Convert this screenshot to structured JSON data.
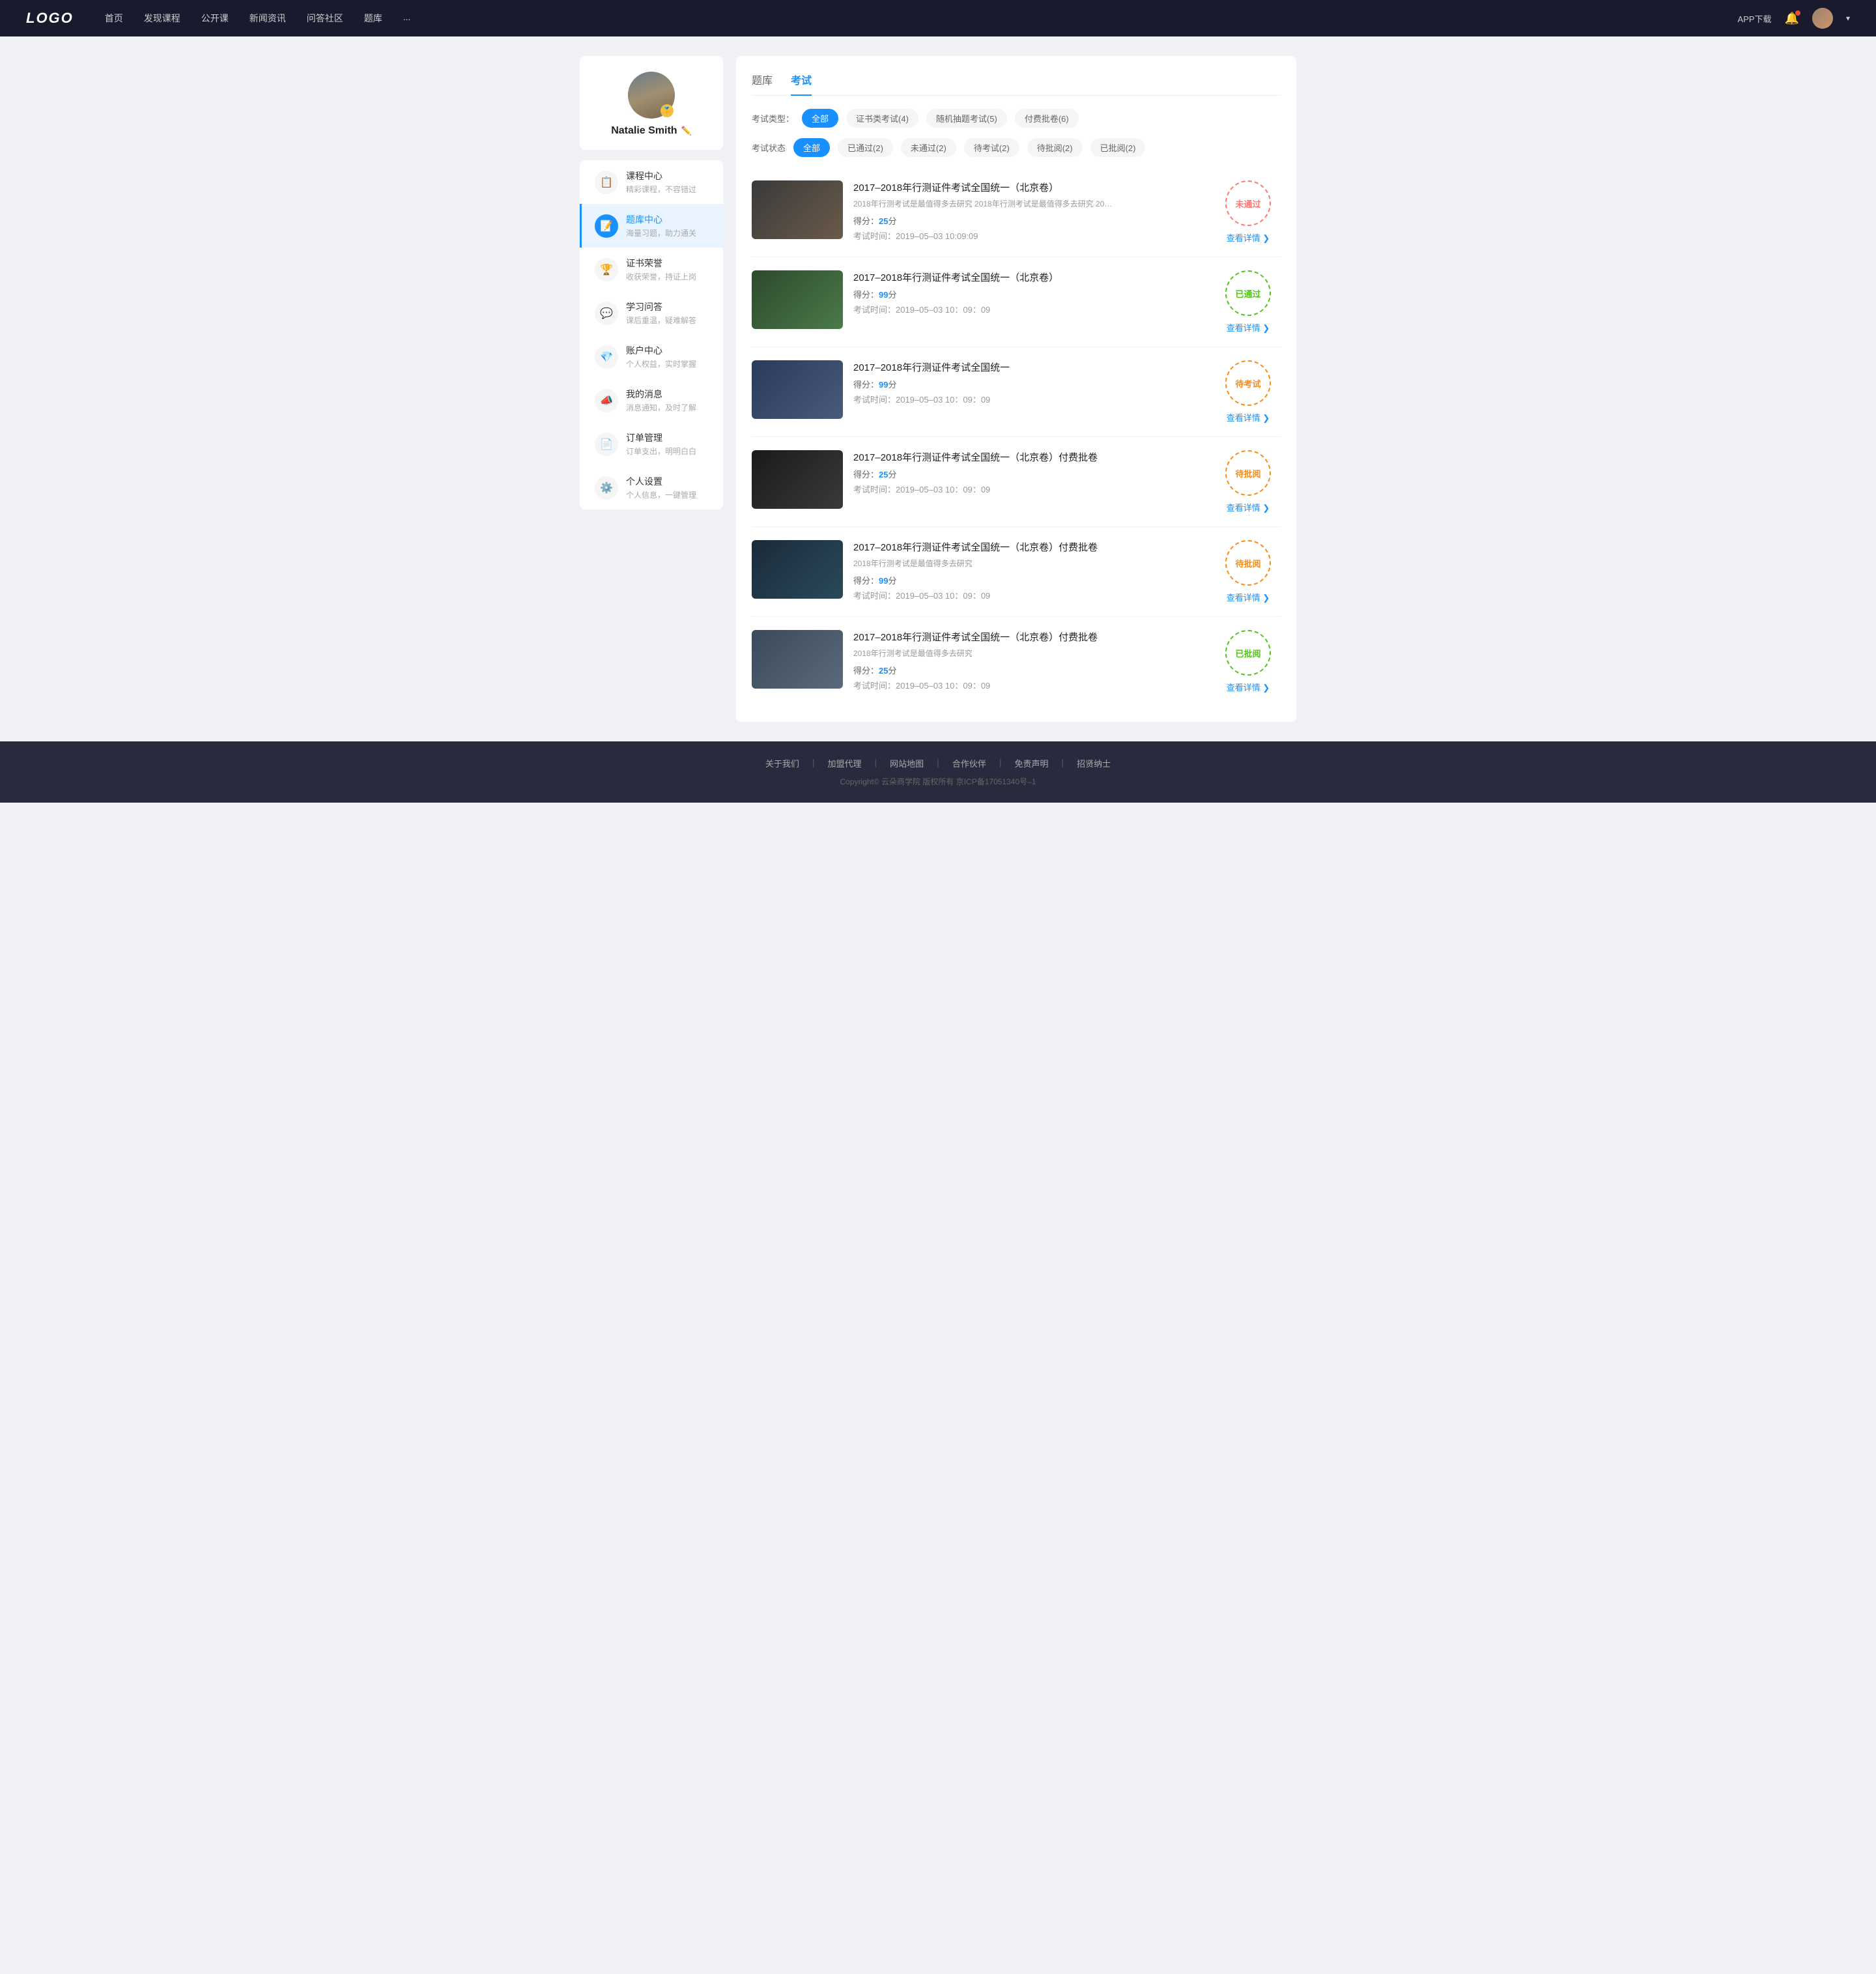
{
  "navbar": {
    "logo": "LOGO",
    "links": [
      "首页",
      "发现课程",
      "公开课",
      "新闻资讯",
      "问答社区",
      "题库",
      "..."
    ],
    "app_download": "APP下载",
    "dropdown_label": "▾"
  },
  "sidebar": {
    "username": "Natalie Smith",
    "badge": "🏅",
    "menu_items": [
      {
        "id": "course",
        "icon": "📋",
        "title": "课程中心",
        "sub": "精彩课程，不容错过"
      },
      {
        "id": "question-bank",
        "icon": "📝",
        "title": "题库中心",
        "sub": "海量习题，助力通关"
      },
      {
        "id": "certificate",
        "icon": "🏆",
        "title": "证书荣誉",
        "sub": "收获荣誉，持证上岗"
      },
      {
        "id": "qa",
        "icon": "💬",
        "title": "学习问答",
        "sub": "课后重温，疑难解答"
      },
      {
        "id": "account",
        "icon": "💎",
        "title": "账户中心",
        "sub": "个人权益，实时掌握"
      },
      {
        "id": "messages",
        "icon": "📣",
        "title": "我的消息",
        "sub": "消息通知，及时了解"
      },
      {
        "id": "orders",
        "icon": "📄",
        "title": "订单管理",
        "sub": "订单支出，明明白白"
      },
      {
        "id": "settings",
        "icon": "⚙️",
        "title": "个人设置",
        "sub": "个人信息，一键管理"
      }
    ]
  },
  "content": {
    "tab_question_bank": "题库",
    "tab_exam": "考试",
    "active_tab": "exam",
    "filter_type_label": "考试类型：",
    "filter_type_options": [
      {
        "label": "全部",
        "active": true
      },
      {
        "label": "证书类考试(4)",
        "active": false
      },
      {
        "label": "随机抽题考试(5)",
        "active": false
      },
      {
        "label": "付费批卷(6)",
        "active": false
      }
    ],
    "filter_status_label": "考试状态",
    "filter_status_options": [
      {
        "label": "全部",
        "active": true
      },
      {
        "label": "已通过(2)",
        "active": false
      },
      {
        "label": "未通过(2)",
        "active": false
      },
      {
        "label": "待考试(2)",
        "active": false
      },
      {
        "label": "待批阅(2)",
        "active": false
      },
      {
        "label": "已批阅(2)",
        "active": false
      }
    ],
    "exams": [
      {
        "id": 1,
        "thumb_class": "thumb-1",
        "title": "2017–2018年行测证件考试全国统一（北京卷）",
        "desc": "2018年行测考试是最值得多去研究 2018年行测考试是最值得多去研究 2018年行...",
        "score_label": "得分：",
        "score": "25",
        "score_unit": "分",
        "time_label": "考试时间：",
        "time": "2019–05–03  10:09:09",
        "stamp_text": "未通过",
        "stamp_class": "stamp-failed",
        "detail_label": "查看详情"
      },
      {
        "id": 2,
        "thumb_class": "thumb-2",
        "title": "2017–2018年行测证件考试全国统一（北京卷）",
        "desc": "",
        "score_label": "得分：",
        "score": "99",
        "score_unit": "分",
        "time_label": "考试时间：",
        "time": "2019–05–03  10：09：09",
        "stamp_text": "已通过",
        "stamp_class": "stamp-passed",
        "detail_label": "查看详情"
      },
      {
        "id": 3,
        "thumb_class": "thumb-3",
        "title": "2017–2018年行测证件考试全国统一",
        "desc": "",
        "score_label": "得分：",
        "score": "99",
        "score_unit": "分",
        "time_label": "考试时间：",
        "time": "2019–05–03  10：09：09",
        "stamp_text": "待考试",
        "stamp_class": "stamp-pending",
        "detail_label": "查看详情"
      },
      {
        "id": 4,
        "thumb_class": "thumb-4",
        "title": "2017–2018年行测证件考试全国统一（北京卷）付费批卷",
        "desc": "",
        "score_label": "得分：",
        "score": "25",
        "score_unit": "分",
        "time_label": "考试时间：",
        "time": "2019–05–03  10：09：09",
        "stamp_text": "待批阅",
        "stamp_class": "stamp-reviewing",
        "detail_label": "查看详情"
      },
      {
        "id": 5,
        "thumb_class": "thumb-5",
        "title": "2017–2018年行测证件考试全国统一（北京卷）付费批卷",
        "desc": "2018年行测考试是最值得多去研究",
        "score_label": "得分：",
        "score": "99",
        "score_unit": "分",
        "time_label": "考试时间：",
        "time": "2019–05–03  10：09：09",
        "stamp_text": "待批阅",
        "stamp_class": "stamp-reviewing",
        "detail_label": "查看详情"
      },
      {
        "id": 6,
        "thumb_class": "thumb-6",
        "title": "2017–2018年行测证件考试全国统一（北京卷）付费批卷",
        "desc": "2018年行测考试是最值得多去研究",
        "score_label": "得分：",
        "score": "25",
        "score_unit": "分",
        "time_label": "考试时间：",
        "time": "2019–05–03  10：09：09",
        "stamp_text": "已批阅",
        "stamp_class": "stamp-reviewed",
        "detail_label": "查看详情"
      }
    ]
  },
  "footer": {
    "links": [
      "关于我们",
      "加盟代理",
      "网站地图",
      "合作伙伴",
      "免责声明",
      "招贤纳士"
    ],
    "copyright": "Copyright© 云朵商学院  版权所有    京ICP备17051340号–1"
  }
}
